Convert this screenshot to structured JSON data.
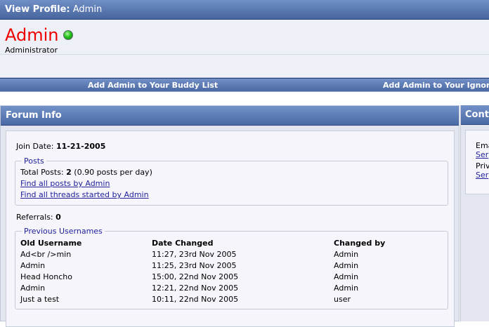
{
  "header": {
    "label": "View Profile:",
    "username": "Admin"
  },
  "profile": {
    "name": "Admin",
    "status": "online",
    "title": "Administrator"
  },
  "buddybar": {
    "add_buddy": "Add Admin to Your Buddy List",
    "add_ignore": "Add Admin to Your Ignore I"
  },
  "forum_info": {
    "heading": "Forum Info",
    "join_date_label": "Join Date:",
    "join_date": "11-21-2005",
    "posts": {
      "legend": "Posts",
      "total_label": "Total Posts:",
      "total": "2",
      "per_day": "(0.90 posts per day)",
      "find_posts": "Find all posts by Admin",
      "find_threads": "Find all threads started by Admin"
    },
    "referrals_label": "Referrals:",
    "referrals": "0",
    "previous_usernames": {
      "legend": "Previous Usernames",
      "columns": [
        "Old Username",
        "Date Changed",
        "Changed by"
      ],
      "rows": [
        [
          "Ad<br />min",
          "11:27, 23rd Nov 2005",
          "Admin"
        ],
        [
          "Admin",
          "11:25, 23rd Nov 2005",
          "Admin"
        ],
        [
          "Head Honcho",
          "15:00, 22nd Nov 2005",
          "Admin"
        ],
        [
          "Admin",
          "12:21, 22nd Nov 2005",
          "Admin"
        ],
        [
          "Just a test",
          "10:11, 22nd Nov 2005",
          "user"
        ]
      ]
    }
  },
  "contact": {
    "heading": "Cont",
    "email_label": "Ema",
    "email_link": "Ser",
    "pm_label": "Priv",
    "pm_link": "Ser"
  },
  "colors": {
    "title_bar": "#5c7cb4",
    "username": "#ee0000",
    "link": "#22229c",
    "online": "#24c21c"
  }
}
